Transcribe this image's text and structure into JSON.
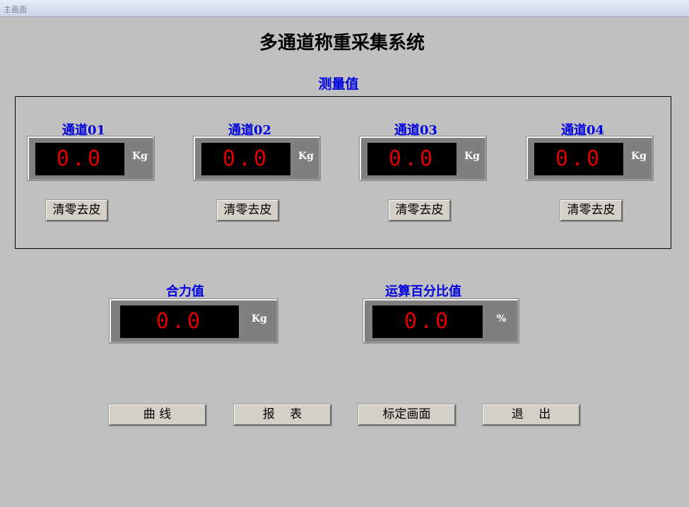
{
  "window": {
    "title": "主画面"
  },
  "header": {
    "title": "多通道称重采集系统"
  },
  "measure_section": {
    "title": "测量值"
  },
  "channels": [
    {
      "label": "通道01",
      "value": "0.0",
      "unit": "Kg",
      "tare_label": "清零去皮"
    },
    {
      "label": "通道02",
      "value": "0.0",
      "unit": "Kg",
      "tare_label": "清零去皮"
    },
    {
      "label": "通道03",
      "value": "0.0",
      "unit": "Kg",
      "tare_label": "清零去皮"
    },
    {
      "label": "通道04",
      "value": "0.0",
      "unit": "Kg",
      "tare_label": "清零去皮"
    }
  ],
  "resultant": {
    "label": "合力值",
    "value": "0.0",
    "unit": "Kg"
  },
  "percentage": {
    "label": "运算百分比值",
    "value": "0.0",
    "unit": "%"
  },
  "buttons": {
    "curve": "曲 线",
    "report": "报    表",
    "calibration": "标定画面",
    "exit": "退    出"
  },
  "colors": {
    "background": "#c0c0c0",
    "label_blue": "#0000e0",
    "display_bg": "#000000",
    "display_text": "#e00000",
    "meter_frame": "#7f7f7f"
  }
}
